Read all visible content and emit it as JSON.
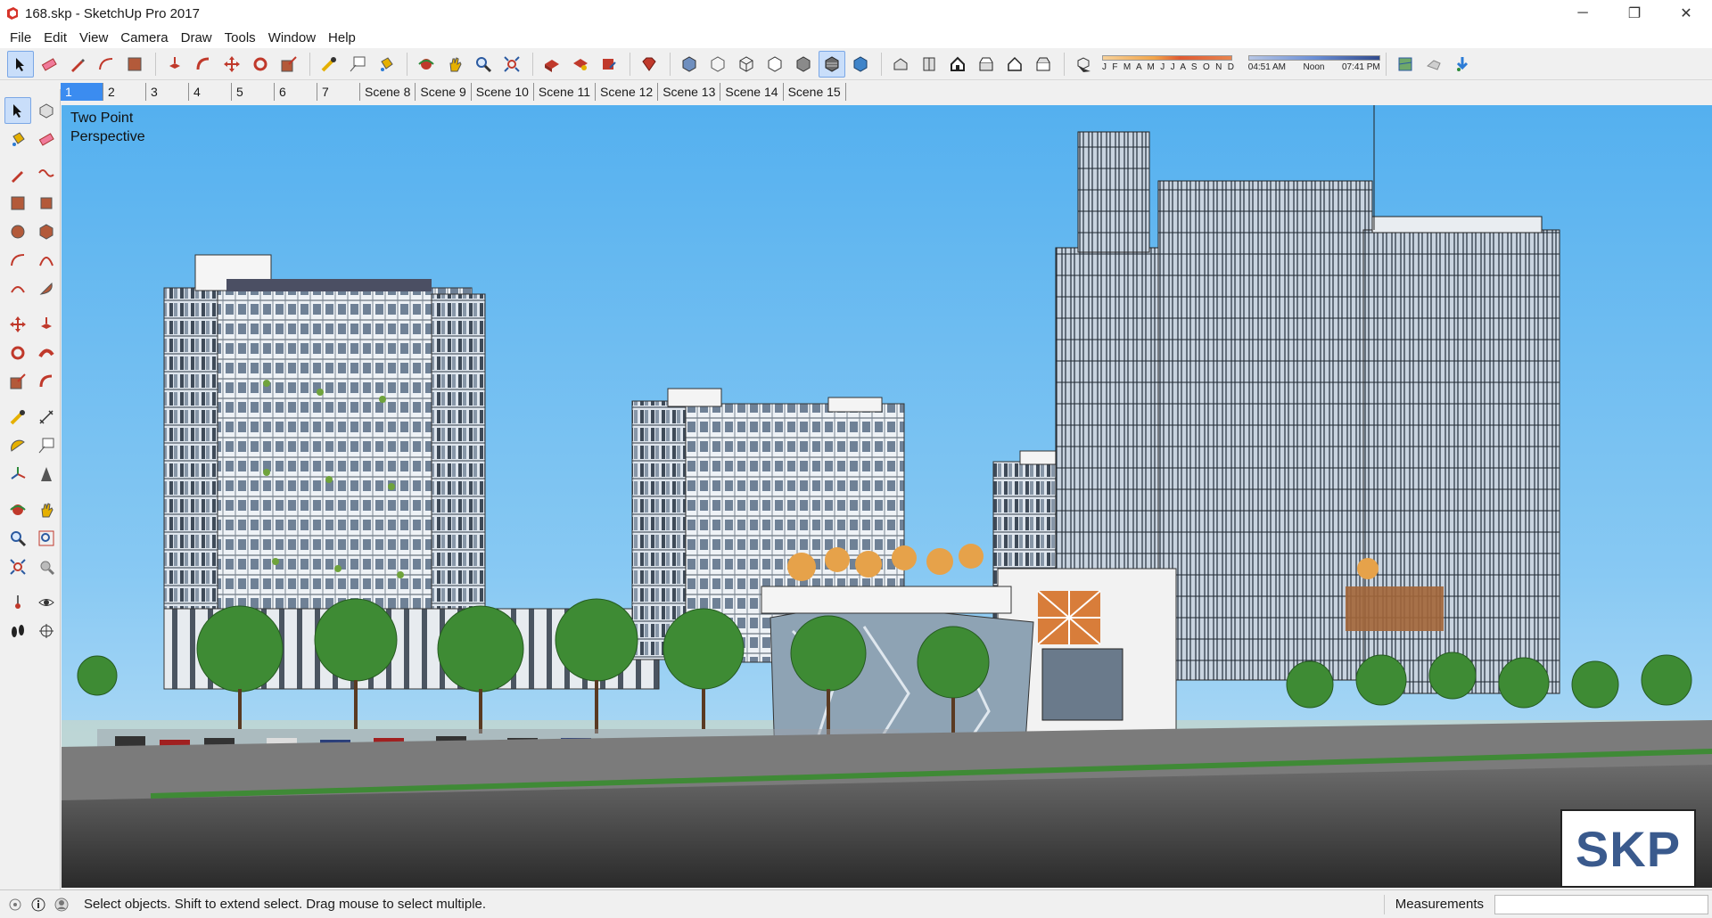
{
  "window": {
    "title": "168.skp - SketchUp Pro 2017",
    "controls": {
      "minimize": "─",
      "restore": "❐",
      "close": "✕"
    }
  },
  "menu": [
    "File",
    "Edit",
    "View",
    "Camera",
    "Draw",
    "Tools",
    "Window",
    "Help"
  ],
  "toolbar": {
    "shadow_months": "J F M A M J J A S O N D",
    "time_start": "04:51 AM",
    "time_mid": "Noon",
    "time_end": "07:41 PM"
  },
  "scenes": [
    "1",
    "2",
    "3",
    "4",
    "5",
    "6",
    "7",
    "Scene 8",
    "Scene 9",
    "Scene 10",
    "Scene 11",
    "Scene 12",
    "Scene 13",
    "Scene 14",
    "Scene 15"
  ],
  "active_scene": "1",
  "viewport": {
    "camera_label": "Two Point\nPerspective",
    "watermark": "SKP"
  },
  "status": {
    "hint": "Select objects. Shift to extend select. Drag mouse to select multiple.",
    "measurements_label": "Measurements",
    "measurements_value": ""
  },
  "colors": {
    "sky_top": "#54b0ef",
    "accent_blue": "#3b8cf0",
    "watermark_text": "#3a5a8d"
  }
}
